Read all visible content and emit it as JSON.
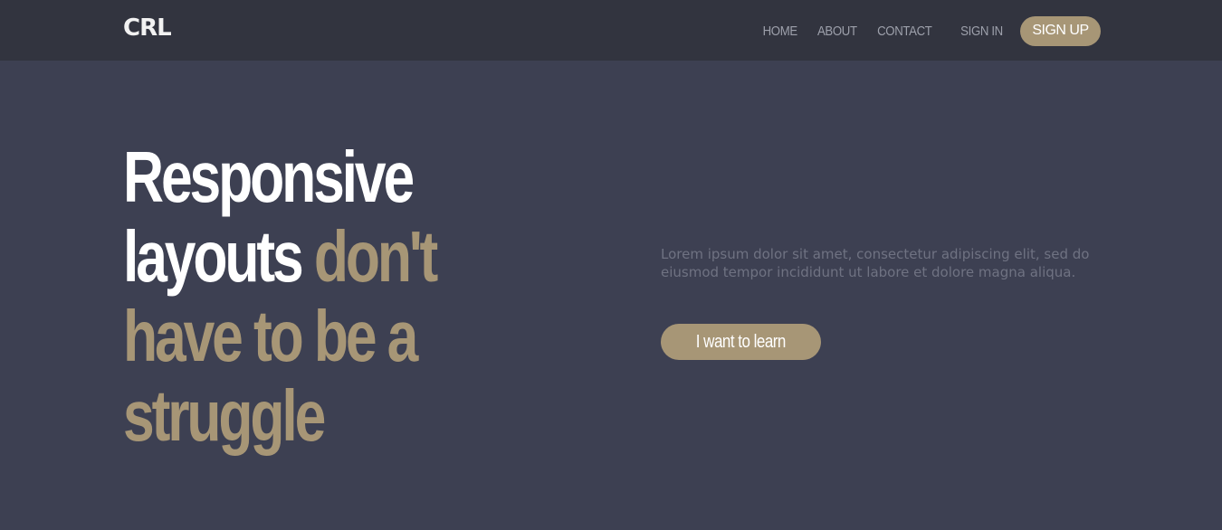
{
  "header": {
    "logo": "CRL",
    "nav": {
      "home": "HOME",
      "about": "ABOUT",
      "contact": "CONTACT",
      "sign_in": "SIGN IN",
      "sign_up": "SIGN UP"
    }
  },
  "hero": {
    "title_white_1": "Responsive",
    "title_white_2": "layouts",
    "title_accent_1": "don't",
    "title_accent_2": "have to be a",
    "title_accent_3": "struggle",
    "description": "Lorem ipsum dolor sit amet, consectetur adipiscing elit, sed do eiusmod tempor incididunt ut labore et dolore magna aliqua.",
    "cta_label": "I want to learn"
  },
  "colors": {
    "background": "#3d4052",
    "header": "#32343f",
    "accent": "#a79676",
    "nav_text": "#9da0ab",
    "description_text": "#6f7282",
    "title_text": "#ffffff"
  }
}
